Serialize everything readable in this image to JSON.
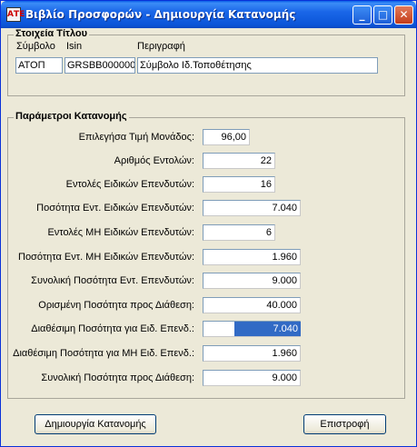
{
  "window": {
    "title": "Βιβλίο Προσφορών - Δημιουργία Κατανομής",
    "app_icon": "ΑΤΕ",
    "controls": {
      "minimize": "_",
      "maximize": "□",
      "close": "✕"
    }
  },
  "stock_group": {
    "legend": "Στοιχεία Τίτλου",
    "columns": {
      "symbol": "Σύμβολο",
      "isin": "Isin",
      "description": "Περιγραφή"
    },
    "values": {
      "symbol": "ΑΤΟΠ",
      "isin": "GRSBB000000",
      "description": "Σύμβολο Ιδ.Τοποθέτησης"
    }
  },
  "allocation_group": {
    "legend": "Παράμετροι Κατανομής",
    "rows": [
      {
        "label": "Επιλεγήσα Τιμή Μονάδος:",
        "value": "96,00"
      },
      {
        "label": "Αριθμός Εντολών:",
        "value": "22"
      },
      {
        "label": "Εντολές Ειδικών Επενδυτών:",
        "value": "16"
      },
      {
        "label": "Ποσότητα Εντ. Ειδικών Επενδυτών:",
        "value": "7.040"
      },
      {
        "label": "Εντολές ΜΗ Ειδικών Επενδυτών:",
        "value": "6"
      },
      {
        "label": "Ποσότητα Εντ. ΜΗ Ειδικών Επενδυτών:",
        "value": "1.960"
      },
      {
        "label": "Συνολική Ποσότητα Εντ. Επενδυτών:",
        "value": "9.000"
      },
      {
        "label": "Ορισμένη Ποσότητα προς Διάθεση:",
        "value": "40.000"
      },
      {
        "label": "Διαθέσιμη Ποσότητα για Ειδ. Επενδ.:",
        "value": "7.040"
      },
      {
        "label": "Διαθέσιμη Ποσότητα για ΜΗ Ειδ. Επενδ.:",
        "value": "1.960"
      },
      {
        "label": "Συνολική Ποσότητα προς Διάθεση:",
        "value": "9.000"
      }
    ]
  },
  "buttons": {
    "create": "Δημιουργία Κατανομής",
    "back": "Επιστροφή"
  }
}
